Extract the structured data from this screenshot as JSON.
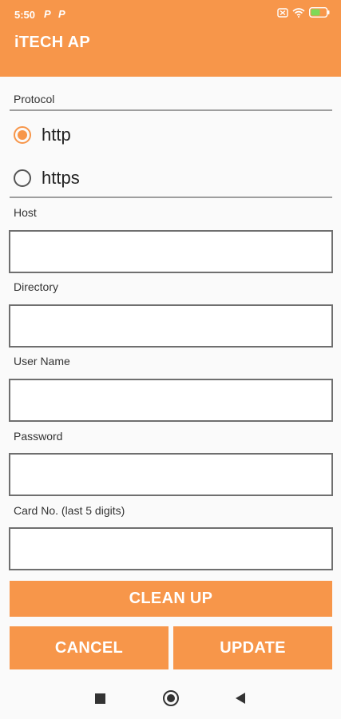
{
  "status_bar": {
    "time": "5:50",
    "notification_icons": [
      "P",
      "P"
    ],
    "battery_level": "58"
  },
  "app": {
    "title": "iTECH AP",
    "accent_color": "#f7964a"
  },
  "form": {
    "protocol_label": "Protocol",
    "protocol_options": [
      "http",
      "https"
    ],
    "protocol_selected": "http",
    "host_label": "Host",
    "host_value": "",
    "directory_label": "Directory",
    "directory_value": "",
    "username_label": "User Name",
    "username_value": "",
    "password_label": "Password",
    "password_value": "",
    "card_label": "Card No. (last 5 digits)",
    "card_value": ""
  },
  "buttons": {
    "clean_up": "CLEAN UP",
    "cancel": "CANCEL",
    "update": "UPDATE"
  },
  "nav_bar": {
    "icons": [
      "recents-icon",
      "home-icon",
      "back-icon"
    ]
  }
}
